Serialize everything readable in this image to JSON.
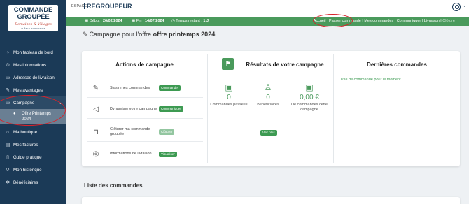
{
  "brand": {
    "line1": "COMMANDE",
    "line2": "GROUPÉE",
    "tagline": "Domaines & Villages",
    "subtag": "CHÂTEAUX DE FRANCE"
  },
  "header": {
    "space_label": "ESPACE",
    "space_name": "REGROUPEUR"
  },
  "status": {
    "start_label": "Début :",
    "start_date": "26/02/2024",
    "end_label": "Fin :",
    "end_date": "14/07/2024",
    "remaining_label": "Temps restant :",
    "remaining_value": "1 J"
  },
  "topnav": {
    "home": "Accueil",
    "order": "Passer commande",
    "my_orders": "Mes commandes",
    "communicate": "Communiquer",
    "delivery": "Livraison",
    "close": "Clôture",
    "sep": "|"
  },
  "sidebar": {
    "items": [
      {
        "label": "Mon tableau de bord",
        "icon": "dashboard-icon"
      },
      {
        "label": "Mes informations",
        "icon": "info-icon"
      },
      {
        "label": "Adresses de livraison",
        "icon": "address-icon"
      },
      {
        "label": "Mes avantages",
        "icon": "advantages-icon"
      },
      {
        "label": "Campagne",
        "icon": "campaign-icon"
      },
      {
        "label": "Ma boutique",
        "icon": "shop-icon"
      },
      {
        "label": "Mes factures",
        "icon": "invoice-icon"
      },
      {
        "label": "Guide pratique",
        "icon": "guide-icon"
      },
      {
        "label": "Mon historique",
        "icon": "history-icon"
      },
      {
        "label": "Bénéficiaires",
        "icon": "beneficiaries-icon"
      }
    ],
    "sub_item": "Offre Printemps 2024"
  },
  "page": {
    "title_prefix": "Campagne pour l'offre",
    "title_offer": "offre printemps 2024"
  },
  "actions": {
    "title": "Actions de campagne",
    "rows": [
      {
        "label": "Saisir mes commandes",
        "button": "Commander"
      },
      {
        "label": "Dynamiser votre campagne",
        "button": "Communiquer"
      },
      {
        "label": "Clôturer ma commande groupée",
        "button": "Clôturer"
      },
      {
        "label": "Informations de livraison",
        "button": "Visualiser"
      }
    ]
  },
  "results": {
    "title": "Résultats de votre campagne",
    "stats": [
      {
        "value": "0",
        "label": "Commandes passées"
      },
      {
        "value": "0",
        "label": "Bénéficiaires"
      },
      {
        "value": "0,00 €",
        "label": "De commandes cette campagne"
      }
    ],
    "more_button": "Voir plus"
  },
  "recent": {
    "title": "Dernières commandes",
    "empty": "Pas de commande pour le moment"
  },
  "orders_list": {
    "title": "Liste des commandes"
  },
  "colors": {
    "sidebar": "#1b3a57",
    "green": "#4a9a5c",
    "button": "#3d9a52",
    "annotation": "#d8222a"
  }
}
